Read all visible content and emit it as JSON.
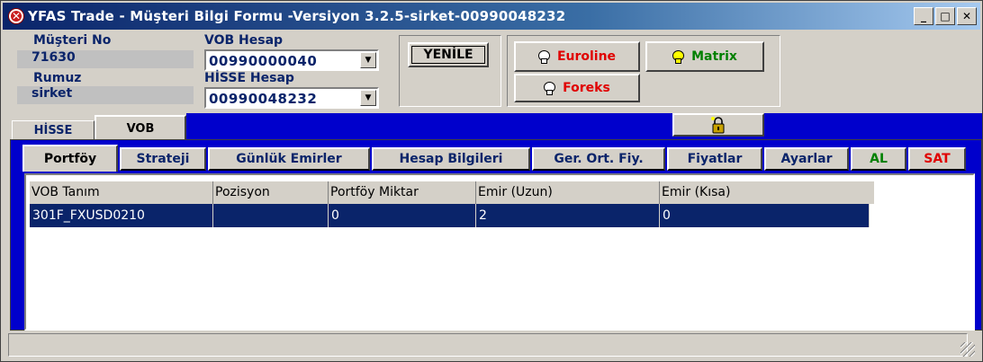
{
  "window": {
    "title": "YFAS Trade - Müşteri Bilgi Formu -Versiyon 3.2.5-sirket-00990048232",
    "minimize_glyph": "_",
    "maximize_glyph": "□",
    "close_glyph": "✕"
  },
  "customer": {
    "number_label": "Müşteri No",
    "number_value": "71630",
    "nickname_label": "Rumuz",
    "nickname_value": "sirket"
  },
  "accounts": {
    "vob_label": "VOB Hesap",
    "vob_value": "00990000040",
    "hisse_label": "HİSSE Hesap",
    "hisse_value": "00990048232"
  },
  "buttons": {
    "refresh": "YENİLE",
    "euroline": "Euroline",
    "matrix": "Matrix",
    "foreks": "Foreks"
  },
  "outer_tabs": [
    {
      "label": "HİSSE"
    },
    {
      "label": "VOB",
      "active": true
    }
  ],
  "sub_tabs": [
    {
      "label": "Portföy",
      "active": true
    },
    {
      "label": "Strateji"
    },
    {
      "label": "Günlük Emirler"
    },
    {
      "label": "Hesap Bilgileri"
    },
    {
      "label": "Ger. Ort. Fiy."
    },
    {
      "label": "Fiyatlar"
    },
    {
      "label": "Ayarlar"
    },
    {
      "label": "AL"
    },
    {
      "label": "SAT"
    }
  ],
  "grid": {
    "columns": [
      "VOB Tanım",
      "Pozisyon",
      "Portföy Miktar",
      "Emir (Uzun)",
      "Emir (Kısa)"
    ],
    "rows": [
      [
        "301F_FXUSD0210",
        "",
        "0",
        "2",
        "0"
      ]
    ]
  },
  "colors": {
    "title_gradient_start": "#0a246a",
    "panel_blue": "#0000cc",
    "selected_row": "#0a246a",
    "label_navy": "#0a246a",
    "euroline_text": "#e00000",
    "matrix_text": "#008000",
    "foreks_text": "#e00000",
    "al_text": "#008000",
    "sat_text": "#e00000"
  },
  "icons": {
    "app": "app-logo-icon",
    "lock": "lock-icon",
    "bulb": "light-bulb-icon",
    "dropdown": "chevron-down-icon"
  }
}
